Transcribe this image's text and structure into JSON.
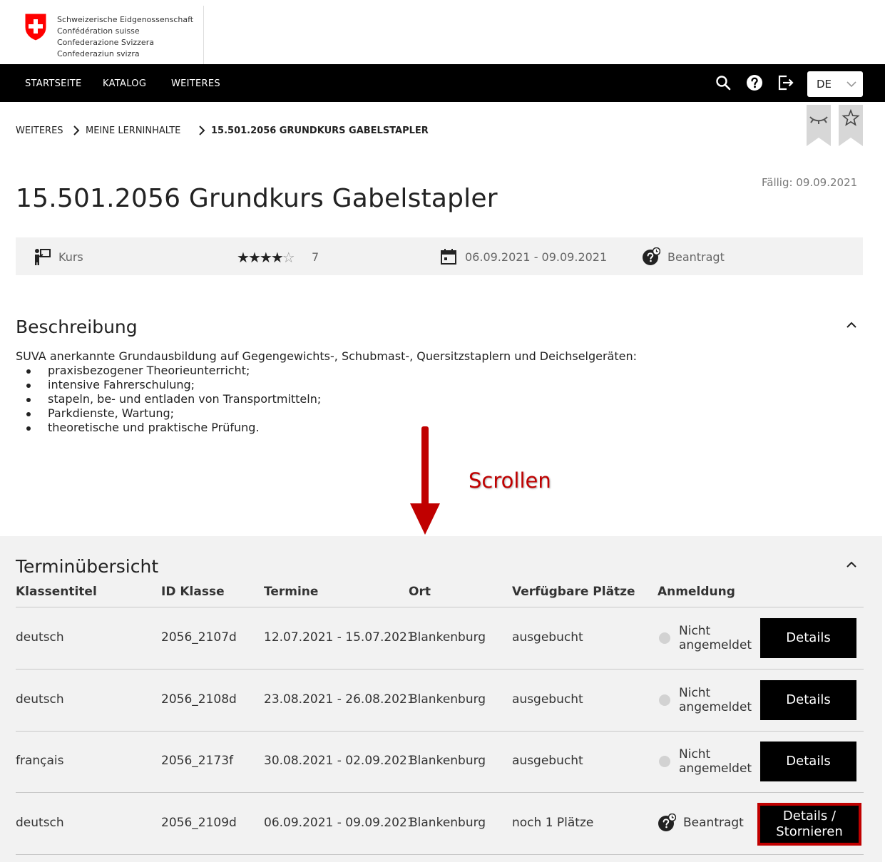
{
  "header": {
    "confederation": [
      "Schweizerische Eidgenossenschaft",
      "Confédération suisse",
      "Confederazione Svizzera",
      "Confederaziun svizra"
    ]
  },
  "nav": {
    "items": [
      "STARTSEITE",
      "KATALOG",
      "WEITERES"
    ],
    "language": "DE"
  },
  "breadcrumb": [
    "WEITERES",
    "MEINE LERNINHALTE",
    "15.501.2056 GRUNDKURS GABELSTAPLER"
  ],
  "course": {
    "due": "Fällig: 09.09.2021",
    "title": "15.501.2056 Grundkurs Gabelstapler",
    "type": "Kurs",
    "rating": 4,
    "rating_max": 5,
    "rating_count": "7",
    "date_range": "06.09.2021 - 09.09.2021",
    "status": "Beantragt"
  },
  "description": {
    "heading": "Beschreibung",
    "intro": "SUVA anerkannte Grundausbildung auf Gegengewichts-, Schubmast-, Quersitzstaplern und Deichselgeräten:",
    "bullets": [
      "praxisbezogener Theorieunterricht;",
      "intensive Fahrerschulung;",
      "stapeln, be- und entladen von Transportmitteln;",
      "Parkdienste, Wartung;",
      "theoretische und praktische Prüfung."
    ]
  },
  "annotation": {
    "scroll_label": "Scrollen"
  },
  "schedule": {
    "heading": "Terminübersicht",
    "columns": [
      "Klassentitel",
      "ID Klasse",
      "Termine",
      "Ort",
      "Verfügbare Plätze",
      "Anmeldung"
    ],
    "rows": [
      {
        "title": "deutsch",
        "id": "2056_2107d",
        "dates": "12.07.2021 - 15.07.2021",
        "place": "Blankenburg",
        "seats": "ausgebucht",
        "status_line1": "Nicht",
        "status_line2": "angemeldet",
        "button": "Details"
      },
      {
        "title": "deutsch",
        "id": "2056_2108d",
        "dates": "23.08.2021 - 26.08.2021",
        "place": "Blankenburg",
        "seats": "ausgebucht",
        "status_line1": "Nicht",
        "status_line2": "angemeldet",
        "button": "Details"
      },
      {
        "title": "français",
        "id": "2056_2173f",
        "dates": "30.08.2021 - 02.09.2021",
        "place": "Blankenburg",
        "seats": "ausgebucht",
        "status_line1": "Nicht",
        "status_line2": "angemeldet",
        "button": "Details"
      },
      {
        "title": "deutsch",
        "id": "2056_2109d",
        "dates": "06.09.2021 - 09.09.2021",
        "place": "Blankenburg",
        "seats": "noch 1 Plätze",
        "status_line1": "Beantragt",
        "status_line2": "",
        "button_line1": "Details /",
        "button_line2": "Stornieren"
      }
    ]
  },
  "colors": {
    "nav_bg": "#000000",
    "swiss_red": "#ff0000",
    "annotation_red": "#c00000",
    "section_bg": "#f2f2f2"
  }
}
